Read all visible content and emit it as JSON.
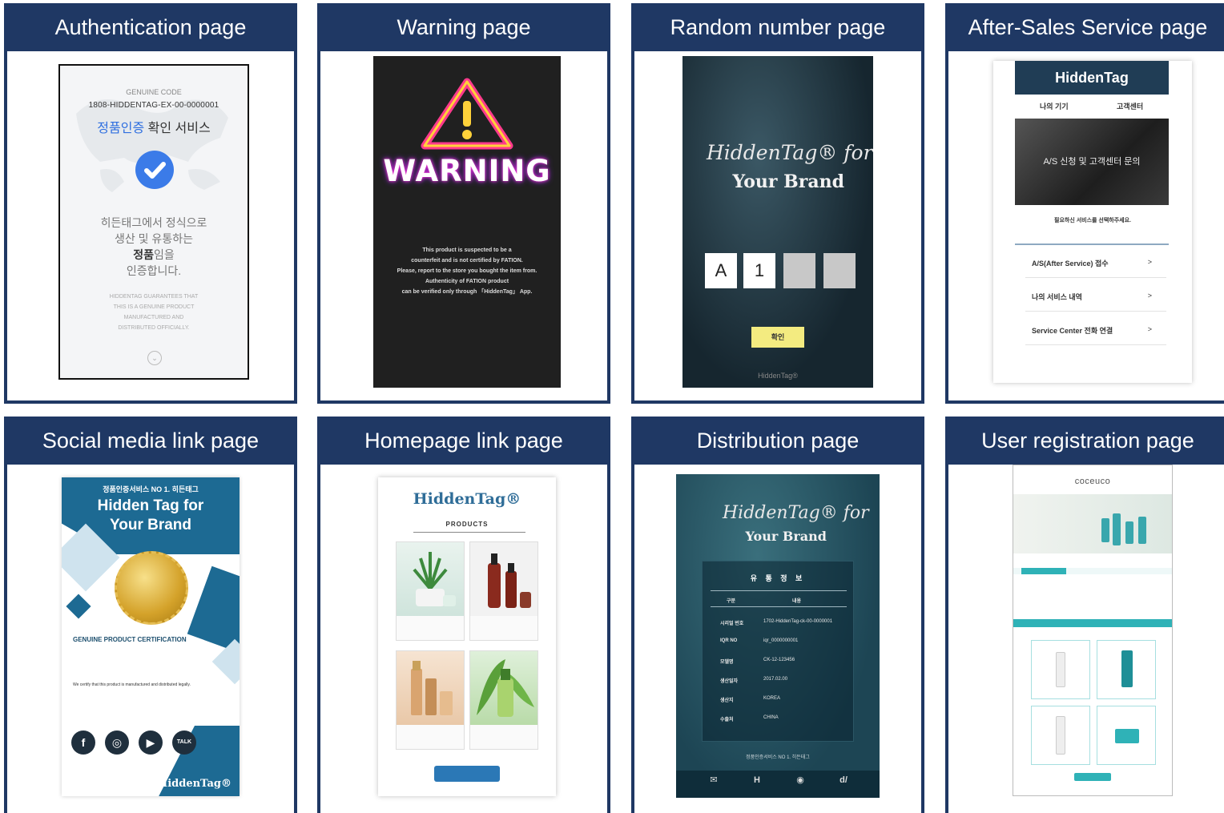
{
  "panels": {
    "authentication": {
      "title": "Authentication page"
    },
    "warning": {
      "title": "Warning page"
    },
    "random_number": {
      "title": "Random number page"
    },
    "after_sales": {
      "title": "After-Sales Service page"
    },
    "social": {
      "title": "Social media link page"
    },
    "homepage": {
      "title": "Homepage link page"
    },
    "distribution": {
      "title": "Distribution page"
    },
    "registration": {
      "title": "User registration page"
    }
  },
  "auth": {
    "genuine_code_label": "GENUINE CODE",
    "code": "1808-HIDDENTAG-EX-00-0000001",
    "service_blue": "정품인증",
    "service_rest": " 확인 서비스",
    "msg_line1": "히든태그에서 정식으로",
    "msg_line2": "생산 및 유통하는",
    "msg_bold": "정품",
    "msg_line3_rest": "임을",
    "msg_line4": "인증합니다.",
    "en_line1": "HIDDENTAG GUARANTEES THAT",
    "en_line2": "THIS IS A GENUINE PRODUCT",
    "en_line3": "MANUFACTURED AND",
    "en_line4": "DISTRIBUTED OFFICIALLY."
  },
  "warning": {
    "word": "WARNING",
    "en_1": "This product is suspected to be a",
    "en_2": "counterfeit and is not certified by FATION.",
    "en_3": "Please, report to the store you bought the item from.",
    "en_4": "Authenticity of FATION product",
    "en_5": "can be verified only through 「HiddenTag」 App."
  },
  "random": {
    "brand_script": "HiddenTag® for",
    "brand_bold": "Your Brand",
    "digit1": "A",
    "digit2": "1",
    "confirm": "확인",
    "footer": "HiddenTag®"
  },
  "aftersales": {
    "header": "HiddenTag",
    "tab_left": "나의 기기",
    "tab_right": "고객센터",
    "banner": "A/S 신청 및 고객센터 문의",
    "select_prompt": "필요하신 서비스를 선택하주세요.",
    "row1": "A/S(After Service) 접수",
    "row2": "나의 서비스 내역",
    "row3": "Service Center 전화 연결",
    "arrow": ">"
  },
  "social": {
    "top_kr": "정품인증서비스 NO 1. 히든태그",
    "title_1": "Hidden Tag for",
    "title_2": "Your Brand",
    "cert_title": "GENUINE PRODUCT CERTIFICATION",
    "cert_en": "We certify that this product is manufactured and distributed legally.",
    "icons": [
      "f",
      "◎",
      "▶",
      "TALK"
    ],
    "logo": "HiddenTag®"
  },
  "homepage": {
    "logo": "HiddenTag®",
    "products_label": "PRODUCTS"
  },
  "distribution": {
    "brand_script": "HiddenTag® for",
    "brand_bold": "Your Brand",
    "card_title": "유 통 정 보",
    "head_key": "구분",
    "head_val": "내용",
    "rows": [
      {
        "key": "시리얼 번호",
        "val": "1702-HiddenTag-ck-00-0000001"
      },
      {
        "key": "IQR NO",
        "val": "iqr_0000000001"
      },
      {
        "key": "모델명",
        "val": "CK-12-123456"
      },
      {
        "key": "생산일자",
        "val": "2017.02.00"
      },
      {
        "key": "생산지",
        "val": "KOREA"
      },
      {
        "key": "수출처",
        "val": "CHINA"
      }
    ],
    "footer": "정품인증서비스 NO 1. 히든태그"
  },
  "registration": {
    "logo": "coceuco"
  },
  "colors": {
    "header_navy": "#1f3864",
    "warning_glow": "#ff2fd0",
    "teal": "#2fb2b7"
  }
}
